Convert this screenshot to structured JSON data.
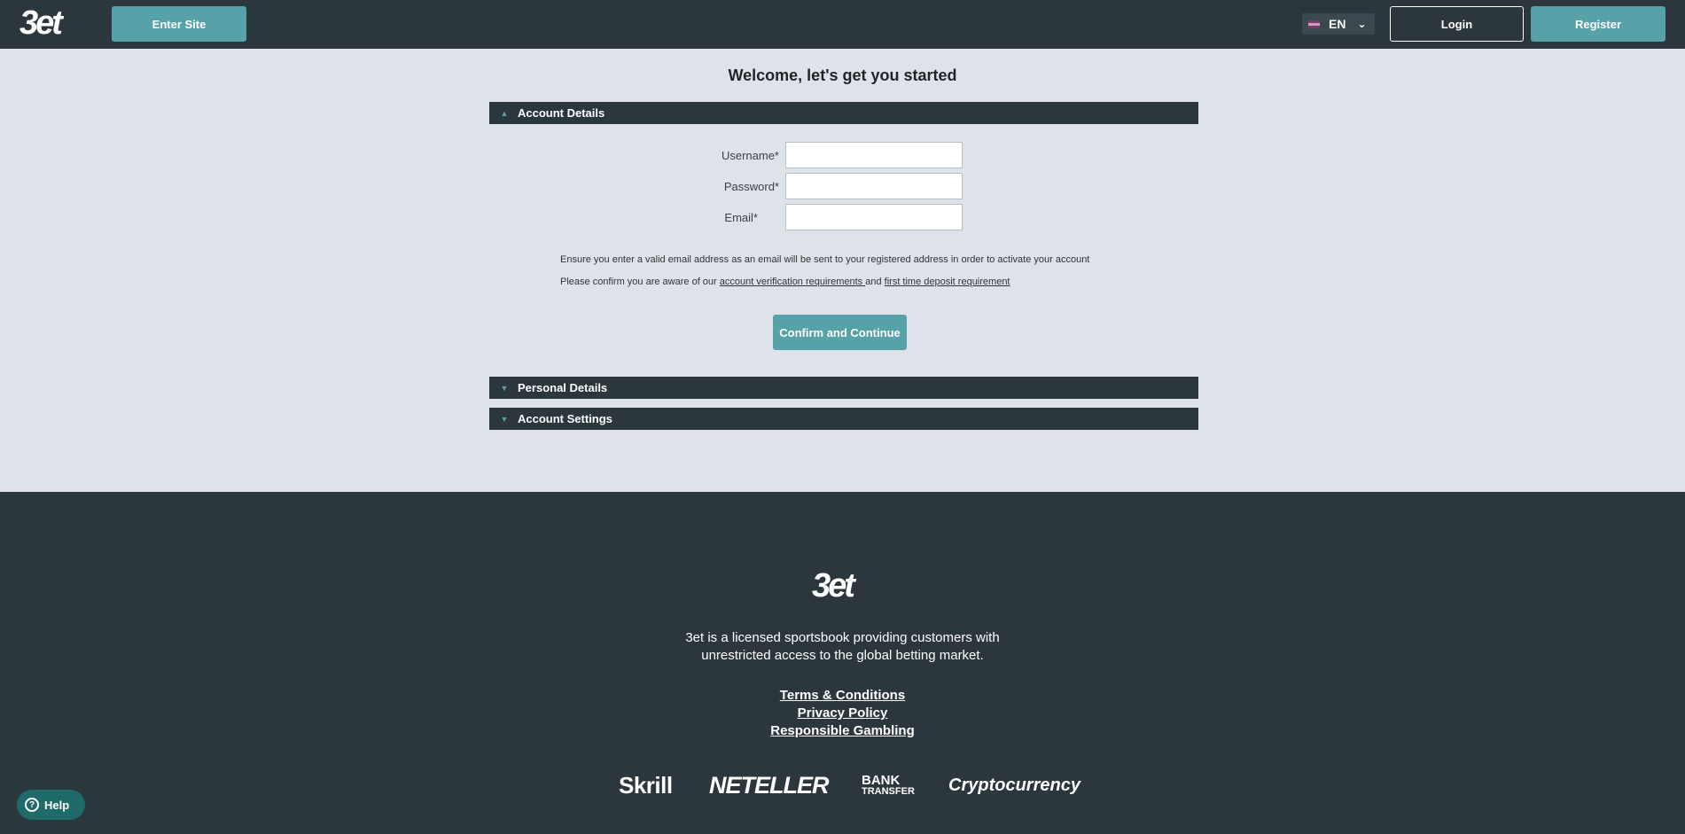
{
  "header": {
    "logo": "3et",
    "enter_site": "Enter Site",
    "language": "EN",
    "login": "Login",
    "register": "Register"
  },
  "main": {
    "welcome": "Welcome, let's get you started",
    "sections": [
      {
        "label": "Account Details",
        "expanded": true
      },
      {
        "label": "Personal Details",
        "expanded": false
      },
      {
        "label": "Account Settings",
        "expanded": false
      }
    ],
    "fields": {
      "username_label": "Username*",
      "password_label": "Password*",
      "email_label": "Email*",
      "username_value": "",
      "password_value": "",
      "email_value": ""
    },
    "note_email": "Ensure you enter a valid email address as an email will be sent to your registered address in order to activate your account",
    "note_confirm_prefix": "Please confirm you are aware of our ",
    "link_verification": "account verification requirements ",
    "note_and": "and ",
    "link_deposit": "first time deposit requirement",
    "confirm_button": "Confirm and Continue"
  },
  "footer": {
    "logo": "3et",
    "tagline_line1": "3et is a licensed sportsbook providing customers with",
    "tagline_line2": "unrestricted access to the global betting market.",
    "links": [
      "Terms & Conditions",
      "Privacy Policy",
      "Responsible Gambling"
    ],
    "payments": {
      "skrill": "Skrill",
      "neteller": "NETELLER",
      "bank_line1": "BANK",
      "bank_line2": "TRANSFER",
      "crypto": "Cryptocurrency"
    }
  },
  "help": {
    "label": "Help"
  },
  "colors": {
    "header_bg": "#2b363d",
    "accent": "#56a2a8",
    "page_bg": "#dde3e8"
  }
}
